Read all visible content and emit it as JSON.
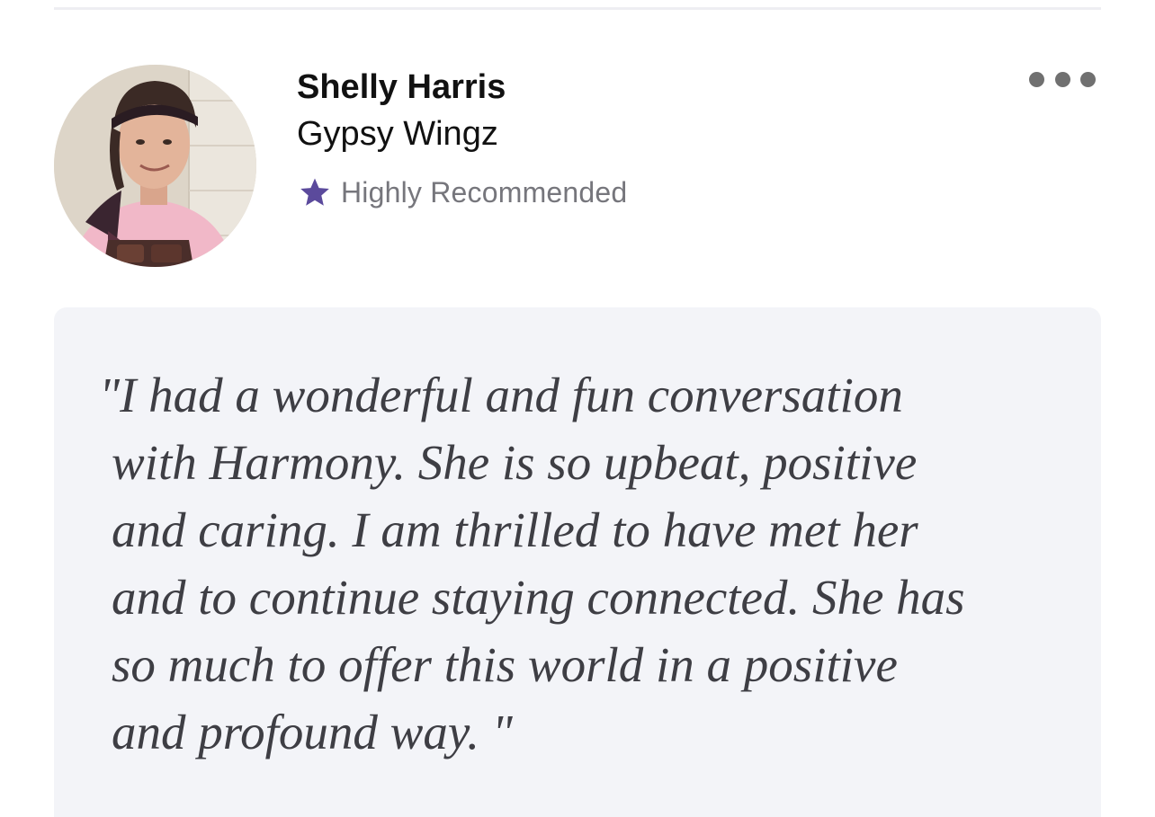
{
  "review": {
    "reviewer": {
      "name": "Shelly Harris",
      "business": "Gypsy Wingz",
      "avatar_icon": "profile-photo"
    },
    "badge": {
      "icon": "star-icon",
      "icon_color": "#5b4a9c",
      "label": "Highly Recommended"
    },
    "menu": {
      "icon": "more-horizontal-icon"
    },
    "quote": "\"I had a wonderful and fun conversation\nwith Harmony. She is so upbeat, positive\nand caring. I am thrilled to have met her\nand to continue staying connected. She has\nso much to offer this world in a positive\nand profound way. \""
  },
  "colors": {
    "card_background": "#f3f4f8",
    "quote_text": "#3e3e44",
    "muted_text": "#76767c"
  }
}
